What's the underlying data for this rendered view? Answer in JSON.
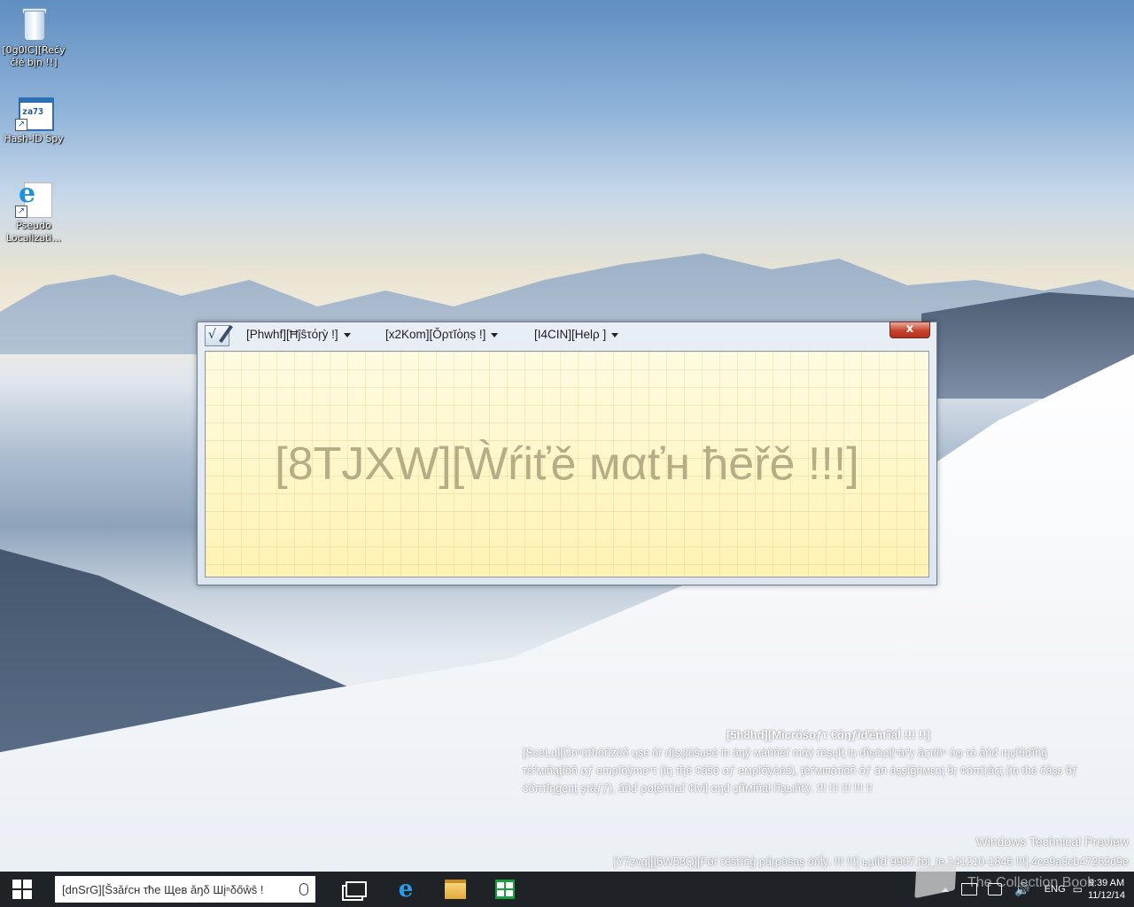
{
  "desktop": {
    "icons": [
      {
        "label": "[0g0IC][Řečy čłé bịn !!]",
        "icon": "recycle-bin-icon"
      },
      {
        "label": "Hash-ID Spy",
        "icon": "hash-id-spy-icon"
      },
      {
        "label": "Pseudo Localizati...",
        "icon": "internet-explorer-document-icon"
      }
    ]
  },
  "math_input_panel": {
    "menus": [
      {
        "label": "[Phwhf][Ħĵŝτόŗỳ !]"
      },
      {
        "label": "[x2Kom][Ŏρτĭὸṇṣ !]"
      },
      {
        "label": "[I4CIN][Ηеlρ ]"
      }
    ],
    "close_label": "x",
    "write_placeholder": "[8TJXW][Ẁŕiťě мαťн ħēřě !!!]"
  },
  "watermark": {
    "confidential_title": "[5h8hd][Micrõśoƒτ €ôŋƒĭďẽṅťĩáĺ !!! !!]",
    "confidential_body": "[SceLu][Ūnⁿüťћöŕĭżëδ ųșє ŏŕ ďįșçļóšụяë ίп äŋŷ мáňñēŕ mάý ŕéșųľţ ίņ ďîşćιρļ¦ⁿäґу ăςτίöⁿ ύφ τό åňđ ıŋçľűďĭňğ τέґмιñąţĭöñ øƒ emρľöŷmeⁿτ (ίŋ τђё ¢ãšë øƒ eмρľőỳėéś), ţёґмιпáτίõñ ỏƒ äṅ áşşĭğṅмεņţ θŗ ¢öπťŗăςţ (íņ ŧћė ĉåşε θƒ ċőπτĭŋġęņţ şτäƒƒ), ăňď ρøţēṅťιаľ ¢ίνїļ αŋđ çřĭмīñäł ŀĩąьιľїťý. !!! !!! !!! !!! !!",
    "build_title": "Windows Technical Preview",
    "build_line": "[Y7zvg][[6W58Q][Fǿŕ ťěšťîňģ pűŗρöśaș óňĺỳ. !!! !!!] ьμíľď 9907.fbl_ie.141210-1846 !!!].4ce9a3cb47262d9e"
  },
  "taskbar": {
    "search_placeholder": "[dnSrG][Šзăŕсн τħе Щев ăŋδ Шįⁿδőŵŝ !",
    "pinned": [
      "task-view-icon",
      "internet-explorer-icon",
      "file-explorer-icon",
      "store-icon"
    ],
    "tray": {
      "language": "ENG",
      "time": "9:39 AM",
      "date": "11/12/14"
    },
    "overlay_text": "The Collection Book"
  }
}
